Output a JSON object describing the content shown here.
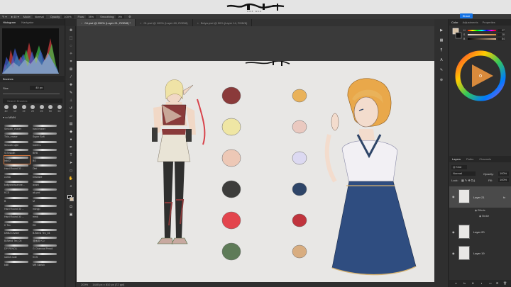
{
  "options_bar": {
    "mode_label": "Mode:",
    "mode_value": "Normal",
    "opacity_label": "Opacity:",
    "opacity_value": "100%",
    "flow_label": "Flow:",
    "flow_value": "78%",
    "smoothing_label": "Smoothing:",
    "smoothing_value": "0%"
  },
  "header": {
    "logo_sub": "ONE WAR",
    "share_label": "Share"
  },
  "doc_tabs": [
    {
      "label": "04.psd @ 200% (Layer 21, RGB/8) *",
      "active": true
    },
    {
      "label": "01.psd @ 100% (Layer 69, RGB/8)",
      "active": false
    },
    {
      "label": "Belya.psd @ 50% (Layer 14, RGB/8)",
      "active": false
    }
  ],
  "left_panel": {
    "histogram_tab": "Histogram",
    "navigator_tab": "Navigator",
    "brushes_title": "Brushes",
    "size_label": "Size",
    "size_value": "40 px",
    "search_placeholder": "Search Brushes",
    "presets": [
      "40",
      "13",
      "19",
      "20",
      "25",
      "50",
      "60"
    ],
    "folder_label": "MAIN",
    "brushes": [
      [
        "Smooth_eraser",
        "hard eraser"
      ],
      [
        "Thin_eraser",
        "Super Soft"
      ],
      [
        "Smooth style",
        "Ink00 s"
      ],
      [
        "S.Smooth",
        "BRB"
      ],
      [
        "Ink00",
        "BS"
      ],
      [
        "Hard Round 30 ...",
        "Dlet"
      ],
      [
        "comic",
        "brisbane"
      ],
      [
        "kafgrannissenne...",
        "avant"
      ],
      [
        "KCS",
        "ak pvd"
      ],
      [
        "B",
        "M"
      ],
      [
        "Hard Round 30 ...",
        "mknpp"
      ],
      [
        "Hard Round 30 ...",
        "mmk"
      ],
      [
        "K Tex",
        "ED"
      ],
      [
        "kWB2 Divider",
        "B.Blend Tex_04"
      ],
      [
        "B.Blend Tex_05",
        "漫画用ペン"
      ],
      [
        "DP PENCIL",
        "G Charcoal Pencil"
      ],
      [
        "sketch.sold",
        "KCS"
      ],
      [
        "kBE",
        "MR Sketch"
      ]
    ]
  },
  "status_bar": {
    "zoom": "200%",
    "doc_info": "1440 px x 810 px (72 ppi)"
  },
  "right_panel": {
    "color_tab": "Color",
    "adjustments_tab": "Adjustments",
    "properties_tab": "Properties",
    "hsb": [
      {
        "label": "H",
        "value": "27"
      },
      {
        "label": "S",
        "value": "28"
      },
      {
        "label": "B",
        "value": "84"
      }
    ],
    "layers_tab": "Layers",
    "paths_tab": "Paths",
    "channels_tab": "Channels",
    "kind_label": "Q Kind",
    "blend_mode": "Normal",
    "opacity_label": "Opacity:",
    "opacity_value": "100%",
    "lock_label": "Lock:",
    "fill_label": "Fill:",
    "fill_value": "100%",
    "layers": [
      {
        "name": "Layer 21",
        "active": true,
        "fx": "fx"
      },
      {
        "name": "Layer 20",
        "active": false
      },
      {
        "name": "Layer 19",
        "active": false
      }
    ],
    "effects_label": "Effects",
    "stroke_label": "Stroke"
  },
  "palette_colors": {
    "left": [
      "#8a3a3a",
      "#efe6a4",
      "#edc8b6",
      "#3d3d3b",
      "#e3454d",
      "#5e7b58"
    ],
    "right": [
      "#e9b25a",
      "#eac9c0",
      "#dcd9f1",
      "#2e4568",
      "#c0343d",
      "#d8ad80"
    ]
  }
}
